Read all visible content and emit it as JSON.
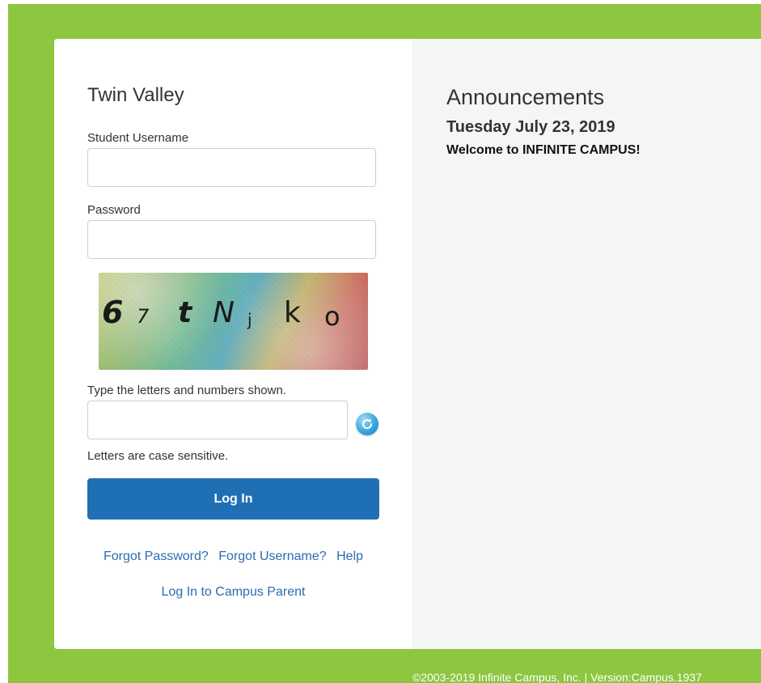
{
  "login": {
    "district_name": "Twin Valley",
    "username_label": "Student Username",
    "username_value": "",
    "password_label": "Password",
    "password_value": "",
    "captcha": {
      "characters": [
        "6",
        "7",
        "t",
        "N",
        "j",
        "k",
        "o"
      ]
    },
    "captcha_label": "Type the letters and numbers shown.",
    "captcha_value": "",
    "refresh_icon": "refresh-icon",
    "case_hint": "Letters are case sensitive.",
    "login_button": "Log In",
    "links": {
      "forgot_password": "Forgot Password?",
      "forgot_username": "Forgot Username?",
      "help": "Help",
      "campus_parent": "Log In to Campus Parent"
    }
  },
  "announcements": {
    "title": "Announcements",
    "date": "Tuesday July 23, 2019",
    "message": "Welcome to INFINITE CAMPUS!"
  },
  "footer": {
    "text": "©2003-2019 Infinite Campus, Inc. | Version:Campus.1937"
  },
  "colors": {
    "background_green": "#8dc63f",
    "primary_button": "#1f6fb5",
    "link": "#2b6cb0"
  }
}
